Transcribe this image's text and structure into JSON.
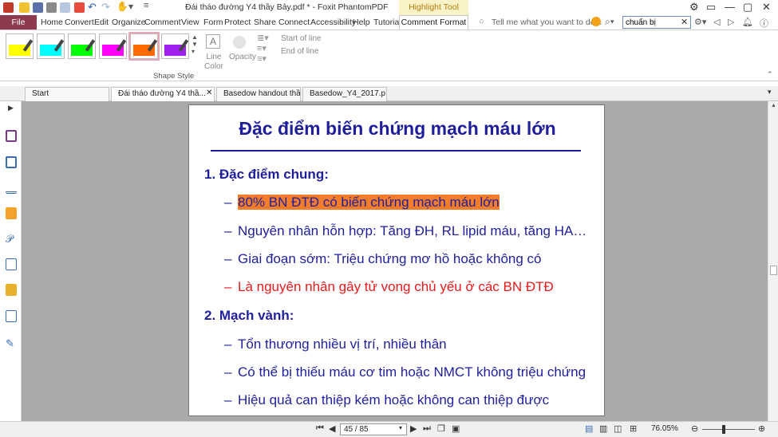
{
  "app": {
    "title": "Đái tháo đường Y4 thầy Bảy.pdf * - Foxit PhantomPDF",
    "context_tab_title": "Highlight Tool"
  },
  "menu": {
    "file": "File",
    "items": [
      "Home",
      "Convert",
      "Edit",
      "Organize",
      "Comment",
      "View",
      "Form",
      "Protect",
      "Share",
      "Connect",
      "Accessibility",
      "Help",
      "Tutorial"
    ],
    "active": "Comment Format",
    "tell_me_placeholder": "Tell me what you want to do...",
    "search_value": "chuẩn bị"
  },
  "ribbon": {
    "swatches": [
      {
        "color": "#ffff00"
      },
      {
        "color": "#00ffff"
      },
      {
        "color": "#00ff00"
      },
      {
        "color": "#ff00ff"
      },
      {
        "color": "#ff6a00",
        "selected": true
      },
      {
        "color": "#a020f0"
      }
    ],
    "line_color_label": "Line Color",
    "opacity_label": "Opacity",
    "start_of_line": "Start of line",
    "end_of_line": "End of line",
    "group_label": "Shape Style"
  },
  "tabs": [
    {
      "label": "Start"
    },
    {
      "label": "Đái tháo đường Y4 thầ...",
      "active": true
    },
    {
      "label": "Basedow handout thầ..."
    },
    {
      "label": "Basedow_Y4_2017.p..."
    }
  ],
  "sidebar_icons": [
    "bookmark-icon",
    "pages-icon",
    "layers-icon",
    "comments-icon",
    "attachments-icon",
    "signature-icon",
    "security-icon",
    "form-icon",
    "certify-icon"
  ],
  "slide": {
    "title": "Đặc điểm biến chứng mạch máu lớn",
    "section1": "1. Đặc điểm chung:",
    "s1_items": [
      "80% BN ĐTĐ có biến chứng mạch máu lớn",
      "Nguyên nhân hỗn hợp: Tăng ĐH, RL lipid máu, tăng HA…",
      "Giai đoạn sớm: Triệu chứng mơ hồ hoặc không có",
      "Là nguyên nhân gây tử vong chủ yếu ở các BN ĐTĐ"
    ],
    "section2": "2. Mạch vành:",
    "s2_items": [
      "Tổn thương nhiều vị trí, nhiều thân",
      "Có thể bị thiếu máu cơ tim hoặc NMCT không triệu chứng",
      "Hiệu quả can thiệp kém hoặc không can thiệp được"
    ],
    "dash": "–",
    "highlight_color": "#f57c2a",
    "text_color": "#1f1f9c",
    "red_color": "#e81b1b"
  },
  "status": {
    "page": "45 / 85",
    "zoom": "76.05%"
  }
}
